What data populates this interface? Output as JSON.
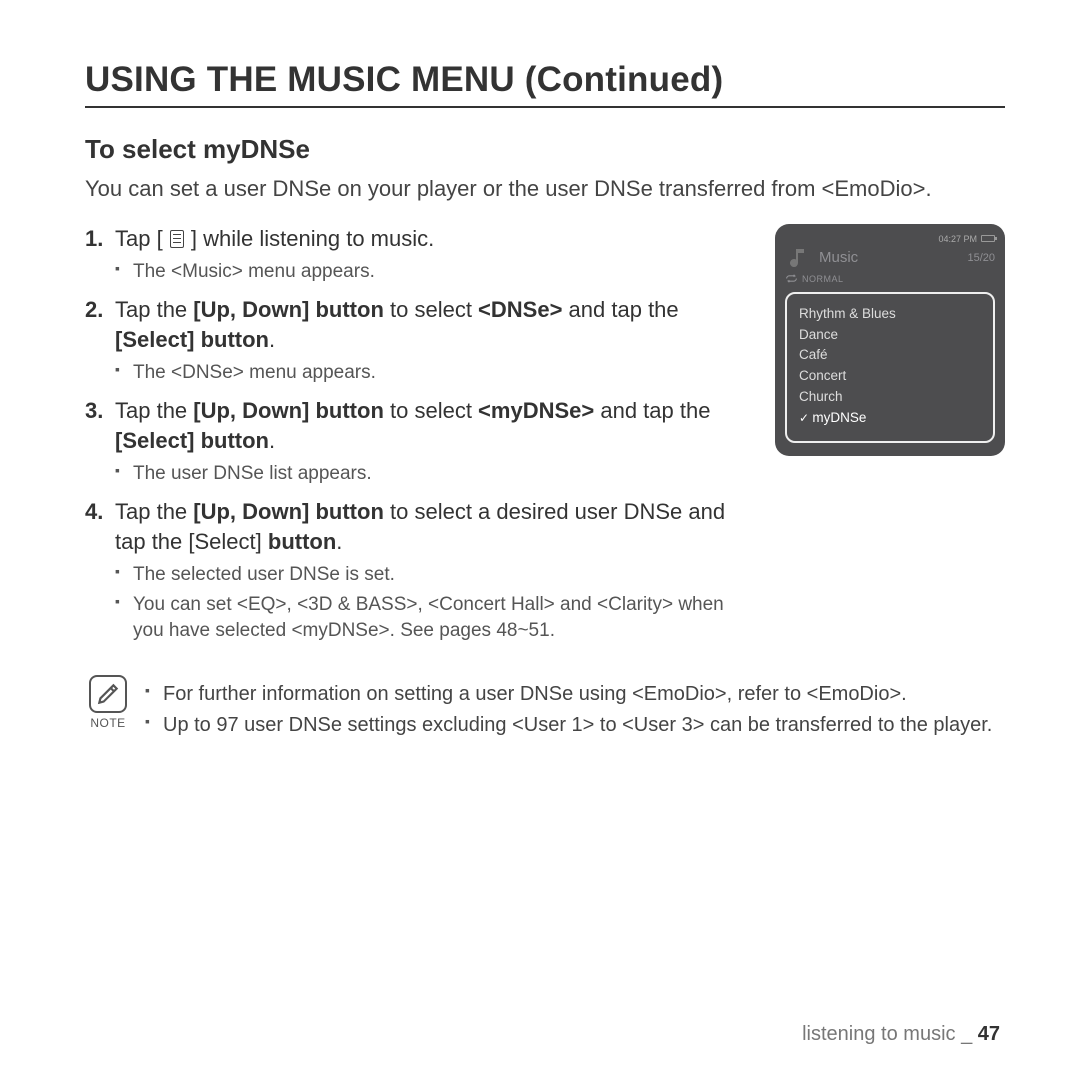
{
  "title": "USING THE MUSIC MENU (Continued)",
  "subhead": "To select myDNSe",
  "intro": "You can set a user DNSe on your player or the user DNSe transferred from <EmoDio>.",
  "steps": [
    {
      "pre": "Tap [",
      "post": "] while listening to music.",
      "subs": [
        "The <Music> menu appears."
      ]
    },
    {
      "html": "Tap the <b>[Up, Down] button</b> to select <b>&lt;DNSe&gt;</b> and tap the <b>[Select] button</b>.",
      "subs": [
        "The <DNSe> menu appears."
      ]
    },
    {
      "html": "Tap the <b>[Up, Down] button</b> to select <b>&lt;myDNSe&gt;</b> and tap the <b>[Select] button</b>.",
      "subs": [
        "The user DNSe list appears."
      ]
    },
    {
      "html": "Tap the <b>[Up, Down] button</b> to select a desired user DNSe and  tap the [Select] <b>button</b>.",
      "subs": [
        "The selected user DNSe is set.",
        "You can set <EQ>, <3D & BASS>, <Concert Hall> and <Clarity> when you have selected <myDNSe>. See pages 48~51."
      ]
    }
  ],
  "note": {
    "label": "NOTE",
    "items": [
      "For further information on setting a user DNSe using <EmoDio>, refer to <EmoDio>.",
      "Up to 97 user DNSe settings excluding <User 1> to <User 3> can be transferred to the player."
    ]
  },
  "device": {
    "time": "04:27 PM",
    "header": "Music",
    "count": "15/20",
    "mode": "NORMAL",
    "menu": [
      "Rhythm & Blues",
      "Dance",
      "Café",
      "Concert",
      "Church",
      "myDNSe"
    ],
    "selected_index": 5
  },
  "footer": {
    "section": "listening to music _",
    "page": "47"
  }
}
